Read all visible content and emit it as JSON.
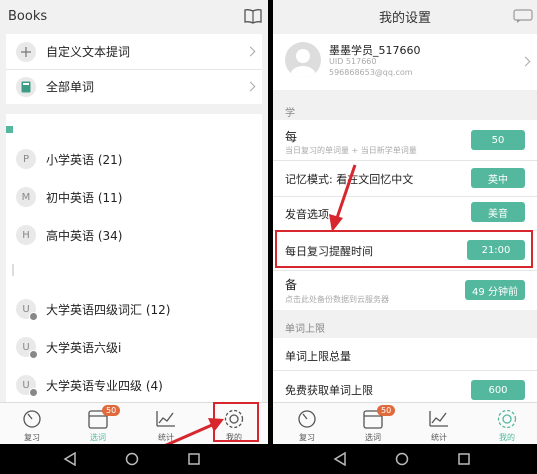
{
  "colors": {
    "accent": "#54b89e",
    "highlight": "#d7262e",
    "badge": "#e06a3c"
  },
  "left": {
    "header": {
      "title": "Books",
      "icon": "book-open-icon"
    },
    "top_items": [
      {
        "icon": "plus-icon",
        "label": "自定义文本提词"
      },
      {
        "icon": "book-icon",
        "label": "全部单词"
      }
    ],
    "book_items": [
      {
        "letter": "P",
        "label": "小学英语 (21)"
      },
      {
        "letter": "M",
        "label": "初中英语 (11)"
      },
      {
        "letter": "H",
        "label": "高中英语 (34)"
      }
    ],
    "univ_items": [
      {
        "letter": "U",
        "label": "大学英语四级词汇 (12)"
      },
      {
        "letter": "U",
        "label": "大学英语六级i"
      },
      {
        "letter": "U",
        "label": "大学英语专业四级 (4)"
      }
    ],
    "tabbar": {
      "badge": "50",
      "tabs": [
        "复习",
        "选词",
        "统计",
        "我的"
      ]
    }
  },
  "right": {
    "header": {
      "title": "我的设置",
      "icon": "chat-icon"
    },
    "profile": {
      "name": "墨墨学员_517660",
      "uid": "UID 517660",
      "email": "596868653@qq.com"
    },
    "section_study": "学",
    "daily_title": "每",
    "daily_sub": "当日复习的单词量 + 当日新学单词量",
    "daily_value": "50",
    "memory_mode": {
      "label": "记忆模式: 看在文回忆中文",
      "value": "英中"
    },
    "pronunciation": {
      "label": "发音选项",
      "value": "美音"
    },
    "reminder": {
      "label": "每日复习提醒时间",
      "value": "21:00"
    },
    "backup": {
      "title": "备",
      "sub": "点击此处备份数据到云服务器",
      "value": "49 分钟前"
    },
    "section_limit": "单词上限",
    "limit_total": {
      "label": "单词上限总量"
    },
    "free_limit": {
      "label": "免费获取单词上限",
      "value": "600"
    },
    "tabbar": {
      "badge": "50",
      "tabs": [
        "复习",
        "选词",
        "统计",
        "我的"
      ]
    }
  }
}
